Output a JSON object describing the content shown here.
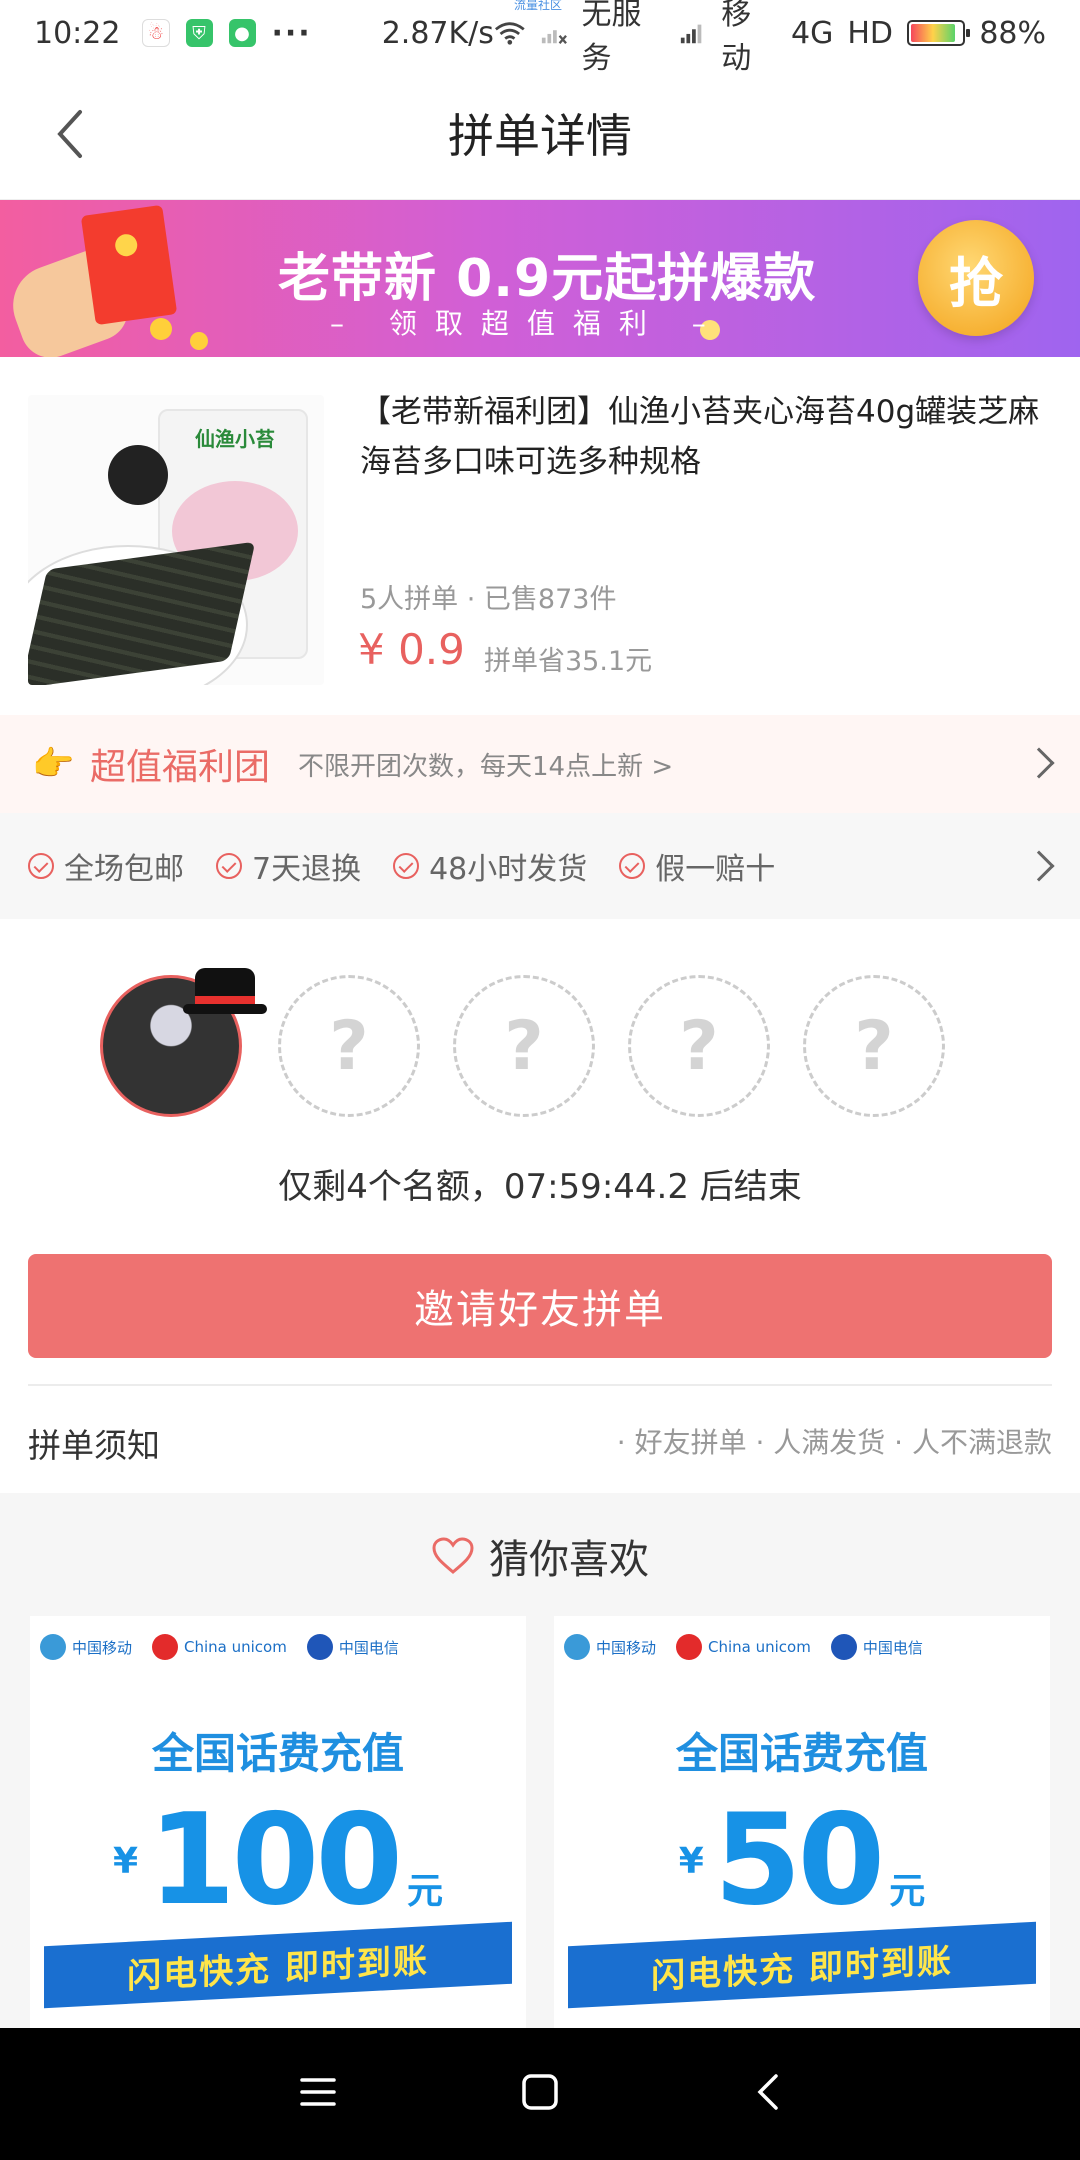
{
  "status_bar": {
    "time": "10:22",
    "speed": "2.87K/s",
    "super_label": "流量社区",
    "no_service": "无服务",
    "carrier": "移动",
    "network": "4G",
    "hd": "HD",
    "battery": "88%",
    "battery_level": 0.88
  },
  "header": {
    "title": "拼单详情"
  },
  "banner": {
    "title": "老带新  0.9元起拼爆款",
    "subtitle": "–  领取超值福利  –",
    "grab_label": "抢"
  },
  "product": {
    "title": "【老带新福利团】仙渔小苔夹心海苔40g罐装芝麻海苔多口味可选多种规格",
    "meta": "5人拼单 · 已售873件",
    "price": "¥ 0.9",
    "saving": "拼单省35.1元",
    "image_brand": "仙渔小苔"
  },
  "welfare": {
    "name": "超值福利团",
    "desc": "不限开团次数，每天14点上新 >"
  },
  "guarantees": [
    {
      "label": "全场包邮"
    },
    {
      "label": "7天退换"
    },
    {
      "label": "48小时发货"
    },
    {
      "label": "假一赔十"
    }
  ],
  "group": {
    "placeholder": "?",
    "countdown": "仅剩4个名额，07:59:44.2  后结束",
    "invite_label": "邀请好友拼单",
    "notice_title": "拼单须知",
    "notice_items": "· 好友拼单 · 人满发货 · 人不满退款"
  },
  "recommend": {
    "title": "猜你喜欢",
    "cards": [
      {
        "carriers": [
          "中国移动",
          "China unicom",
          "中国电信"
        ],
        "headline": "全国话费充值",
        "yen": "¥",
        "amount": "100",
        "unit": "元",
        "ribbon": "闪电快充  即时到账"
      },
      {
        "carriers": [
          "中国移动",
          "China unicom",
          "中国电信"
        ],
        "headline": "全国话费充值",
        "yen": "¥",
        "amount": "50",
        "unit": "元",
        "ribbon": "闪电快充  即时到账"
      }
    ]
  },
  "colors": {
    "accent": "#ee7271",
    "price": "#e8615f",
    "banner_start": "#f35ea0",
    "banner_end": "#9f64ef"
  }
}
